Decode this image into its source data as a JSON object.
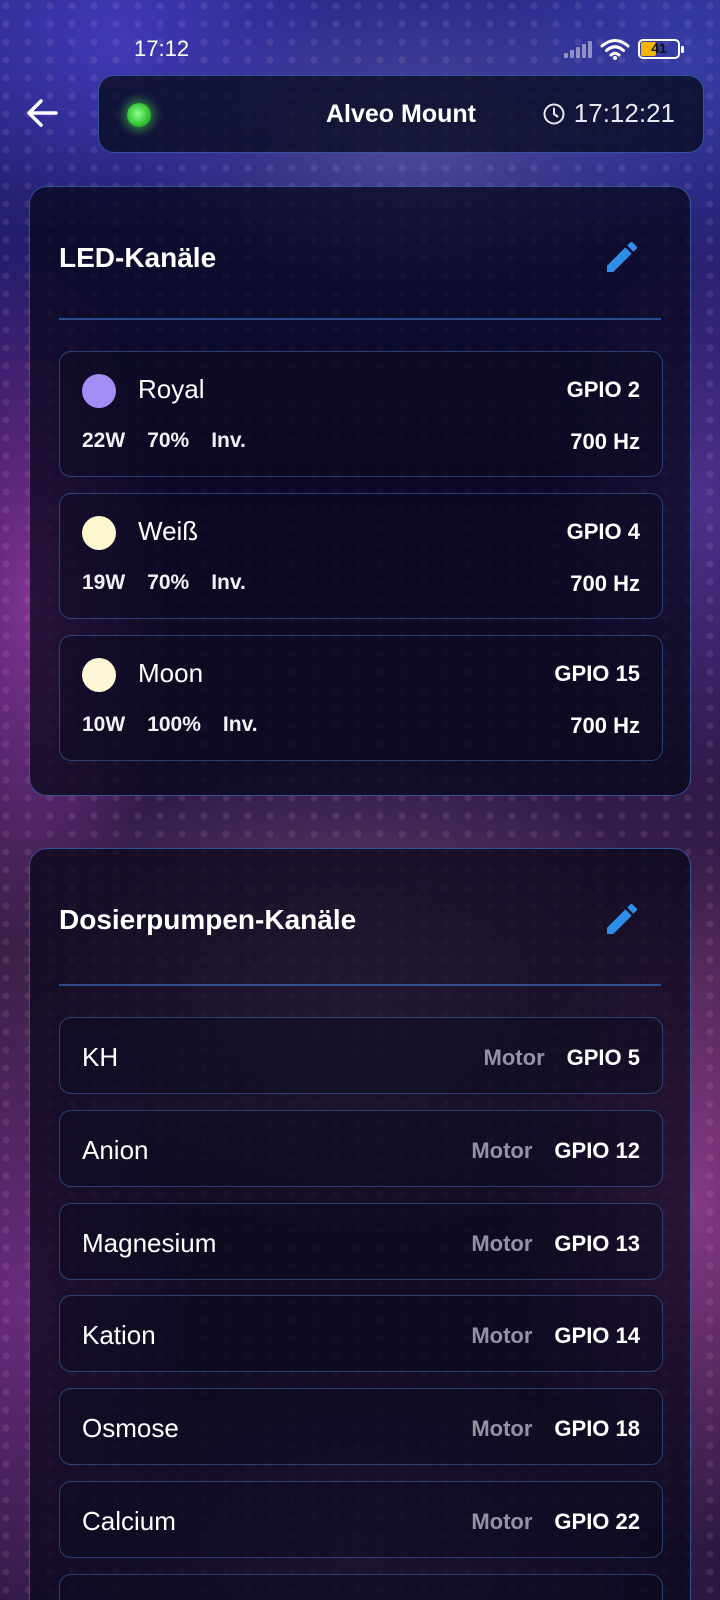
{
  "status_bar": {
    "time": "17:12",
    "battery_level": "41",
    "icons": [
      "signal-icon",
      "wifi-icon",
      "battery-icon"
    ]
  },
  "header": {
    "device_name": "Alveo Mount",
    "time": "17:12:21",
    "status_color": "#3fd43f"
  },
  "led_section": {
    "title": "LED-Kanäle",
    "channels": [
      {
        "name": "Royal",
        "color": "#a48cf5",
        "gpio": "GPIO 2",
        "power": "22W",
        "percent": "70%",
        "inv": "Inv.",
        "freq": "700 Hz"
      },
      {
        "name": "Weiß",
        "color": "#fdf7cf",
        "gpio": "GPIO 4",
        "power": "19W",
        "percent": "70%",
        "inv": "Inv.",
        "freq": "700 Hz"
      },
      {
        "name": "Moon",
        "color": "#fdf7d8",
        "gpio": "GPIO 15",
        "power": "10W",
        "percent": "100%",
        "inv": "Inv.",
        "freq": "700 Hz"
      }
    ]
  },
  "pump_section": {
    "title": "Dosierpumpen-Kanäle",
    "channels": [
      {
        "name": "KH",
        "type": "Motor",
        "gpio": "GPIO 5"
      },
      {
        "name": "Anion",
        "type": "Motor",
        "gpio": "GPIO 12"
      },
      {
        "name": "Magnesium",
        "type": "Motor",
        "gpio": "GPIO 13"
      },
      {
        "name": "Kation",
        "type": "Motor",
        "gpio": "GPIO 14"
      },
      {
        "name": "Osmose",
        "type": "Motor",
        "gpio": "GPIO 18"
      },
      {
        "name": "Calcium",
        "type": "Motor",
        "gpio": "GPIO 22"
      }
    ]
  },
  "colors": {
    "accent": "#2f8fe8",
    "border": "#4682dc"
  }
}
